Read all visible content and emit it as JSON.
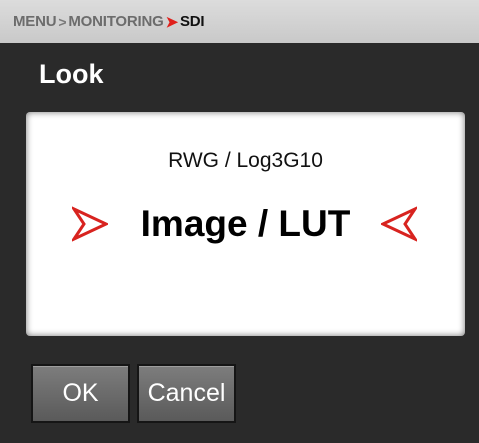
{
  "breadcrumb": {
    "items": [
      "MENU",
      "MONITORING",
      "SDI"
    ],
    "separator": ">",
    "active_separator_color": "#e0201b"
  },
  "header": {
    "title": "Look"
  },
  "panel": {
    "subtitle": "RWG / Log3G10",
    "value": "Image / LUT",
    "left_arrow_icon": "chevron-right-icon",
    "right_arrow_icon": "chevron-left-icon",
    "arrow_color": "#d8231f"
  },
  "buttons": {
    "ok_label": "OK",
    "cancel_label": "Cancel"
  }
}
